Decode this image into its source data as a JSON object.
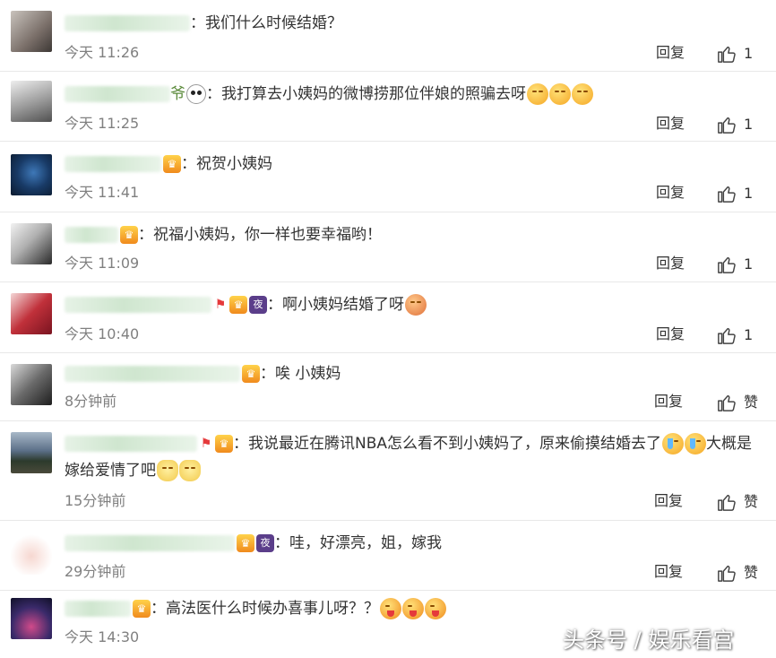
{
  "comments": [
    {
      "name_suffix": "",
      "badges": [],
      "text": "：我们什么时候结婚？",
      "emojis": [],
      "time": "今天 11:26",
      "reply": "回复",
      "likes": "1"
    },
    {
      "name_suffix": "爷",
      "badges": [
        "panda-emoji"
      ],
      "text": "：我打算去小姨妈的微博捞那位伴娘的照骗去呀",
      "emojis": [
        "smile",
        "smile",
        "smile"
      ],
      "time": "今天 11:25",
      "reply": "回复",
      "likes": "1"
    },
    {
      "name_suffix": "",
      "badges": [
        "vip-badge"
      ],
      "text": "：祝贺小姨妈",
      "emojis": [],
      "time": "今天 11:41",
      "reply": "回复",
      "likes": "1"
    },
    {
      "name_suffix": "",
      "badges": [
        "vip-badge"
      ],
      "text": "：祝福小姨妈，你一样也要幸福哟！",
      "emojis": [],
      "time": "今天 11:09",
      "reply": "回复",
      "likes": "1"
    },
    {
      "name_suffix": "",
      "badges": [
        "flag-badge",
        "vip-badge",
        "night-badge"
      ],
      "night_label": "夜",
      "text": "：啊小姨妈结婚了呀",
      "emojis": [
        "shy"
      ],
      "time": "今天 10:40",
      "reply": "回复",
      "likes": "1"
    },
    {
      "name_suffix": "",
      "badges": [
        "vip-badge"
      ],
      "text": "：唉 小姨妈",
      "emojis": [],
      "time": "8分钟前",
      "reply": "回复",
      "likes": "赞"
    },
    {
      "name_suffix": "",
      "badges": [
        "flag-badge",
        "vip-badge"
      ],
      "text": "：我说最近在腾讯NBA怎么看不到小姨妈了，原来偷摸结婚去了",
      "text2": "大概是嫁给爱情了吧",
      "emojis": [
        "cry",
        "cry"
      ],
      "emojis2": [
        "cat",
        "cat"
      ],
      "time": "15分钟前",
      "reply": "回复",
      "likes": "赞"
    },
    {
      "name_suffix": "",
      "badges": [
        "vip-badge",
        "night-badge"
      ],
      "night_label": "夜",
      "text": "：哇，好漂亮，姐，嫁我",
      "emojis": [],
      "time": "29分钟前",
      "reply": "回复",
      "likes": "赞"
    },
    {
      "name_suffix": "",
      "badges": [
        "vip-badge"
      ],
      "text": "：高法医什么时候办喜事儿呀？？",
      "emojis": [
        "tongue",
        "tongue",
        "tongue"
      ],
      "time": "今天 14:30",
      "reply": "",
      "likes": ""
    }
  ],
  "watermark": "头条号 / 娱乐看宫",
  "colors": {
    "accent_green": "#5a8a3a",
    "meta_gray": "#808080",
    "divider": "#e8e8e8"
  }
}
